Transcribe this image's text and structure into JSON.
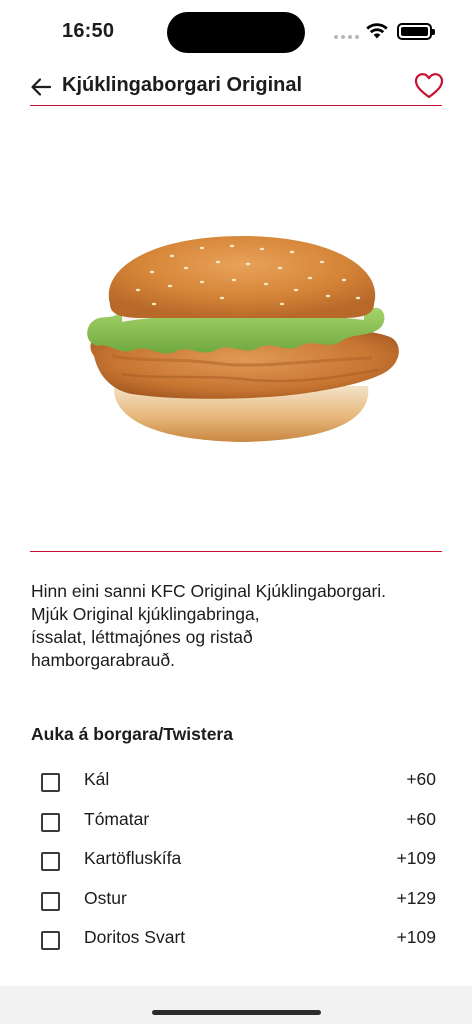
{
  "status_bar": {
    "time": "16:50"
  },
  "header": {
    "title": "Kjúklingaborgari Original",
    "back_icon": "arrow-left-icon",
    "favorite_icon": "heart-outline-icon",
    "accent_color": "#c8102e"
  },
  "product": {
    "image_icon": "chicken-burger-image",
    "description": "Hinn eini sanni KFC Original Kjúklingaborgari. Mjúk Original kjúklingabringa, íssalat, léttmajónes og ristað hamborgarabrauð.",
    "description_lines": [
      "Hinn eini sanni KFC Original Kjúklingaborgari.",
      "Mjúk Original kjúklingabringa,",
      "íssalat, léttmajónes og ristað",
      "hamborgarabrauð."
    ]
  },
  "extras": {
    "title": "Auka á borgara/Twistera",
    "items": [
      {
        "name": "Kál",
        "price": "+60",
        "checked": false
      },
      {
        "name": "Tómatar",
        "price": "+60",
        "checked": false
      },
      {
        "name": "Kartöfluskífa",
        "price": "+109",
        "checked": false
      },
      {
        "name": "Ostur",
        "price": "+129",
        "checked": false
      },
      {
        "name": "Doritos Svart",
        "price": "+109",
        "checked": false
      }
    ]
  }
}
